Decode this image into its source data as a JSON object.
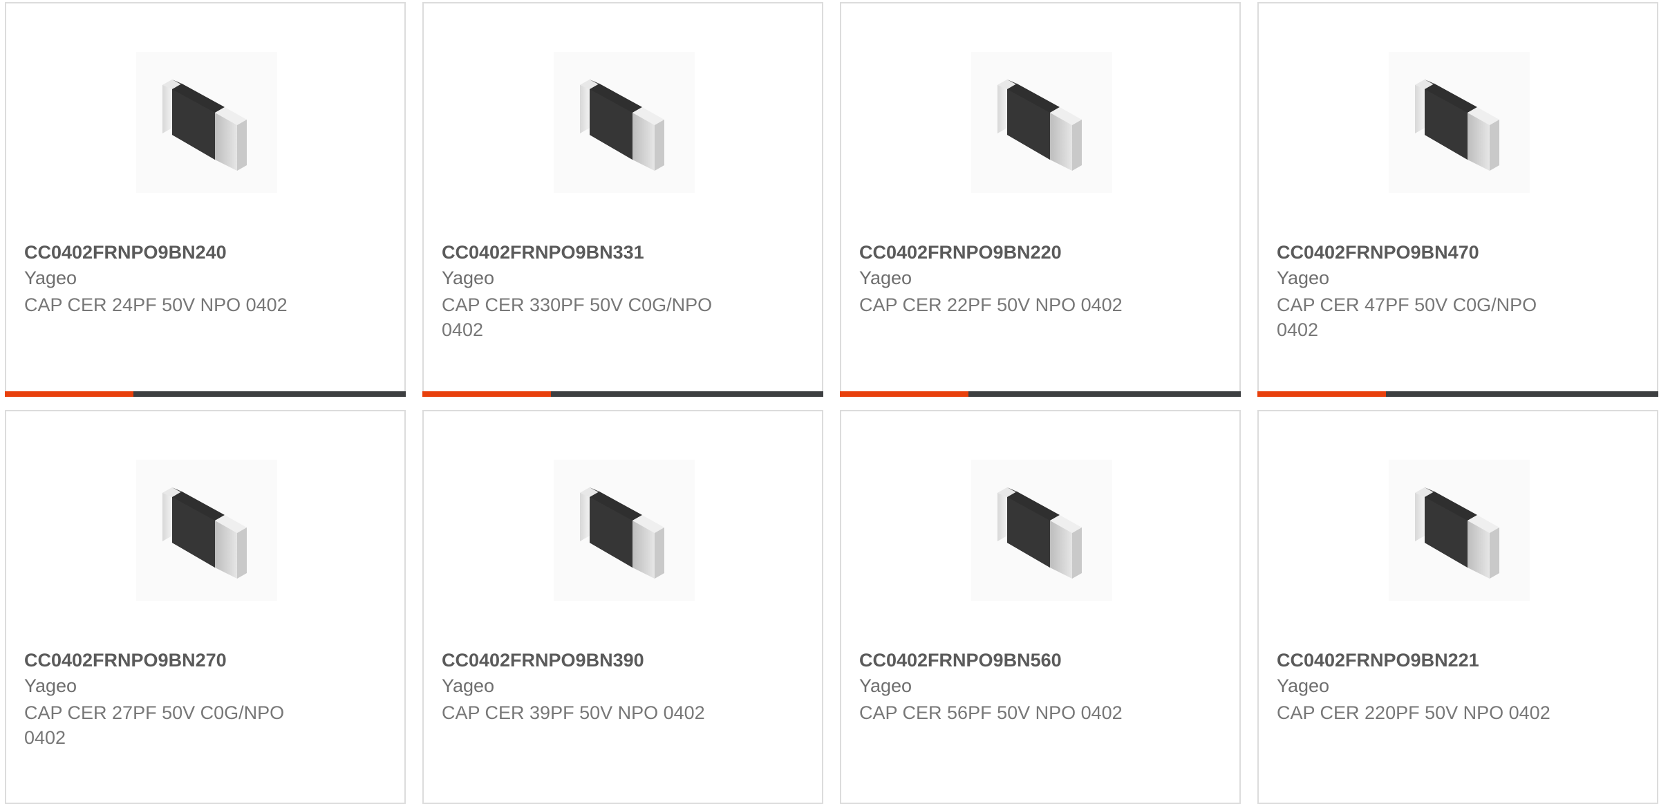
{
  "colors": {
    "accent": "#e8400c",
    "bar_track": "#3d3f41",
    "card_border": "#dcdcdc"
  },
  "products": [
    {
      "part_number": "CC0402FRNPO9BN240",
      "manufacturer": "Yageo",
      "description": "CAP CER 24PF 50V NPO 0402",
      "image_icon": "capacitor-chip-image",
      "progress": 0.32
    },
    {
      "part_number": "CC0402FRNPO9BN331",
      "manufacturer": "Yageo",
      "description": "CAP CER 330PF 50V C0G/NPO 0402",
      "image_icon": "capacitor-chip-image",
      "progress": 0.32
    },
    {
      "part_number": "CC0402FRNPO9BN220",
      "manufacturer": "Yageo",
      "description": "CAP CER 22PF 50V NPO 0402",
      "image_icon": "capacitor-chip-image",
      "progress": 0.32
    },
    {
      "part_number": "CC0402FRNPO9BN470",
      "manufacturer": "Yageo",
      "description": "CAP CER 47PF 50V C0G/NPO 0402",
      "image_icon": "capacitor-chip-image",
      "progress": 0.32
    },
    {
      "part_number": "CC0402FRNPO9BN270",
      "manufacturer": "Yageo",
      "description": "CAP CER 27PF 50V C0G/NPO 0402",
      "image_icon": "capacitor-chip-image"
    },
    {
      "part_number": "CC0402FRNPO9BN390",
      "manufacturer": "Yageo",
      "description": "CAP CER 39PF 50V NPO 0402",
      "image_icon": "capacitor-chip-image"
    },
    {
      "part_number": "CC0402FRNPO9BN560",
      "manufacturer": "Yageo",
      "description": "CAP CER 56PF 50V NPO 0402",
      "image_icon": "capacitor-chip-image"
    },
    {
      "part_number": "CC0402FRNPO9BN221",
      "manufacturer": "Yageo",
      "description": "CAP CER 220PF 50V NPO 0402",
      "image_icon": "capacitor-chip-image"
    }
  ]
}
